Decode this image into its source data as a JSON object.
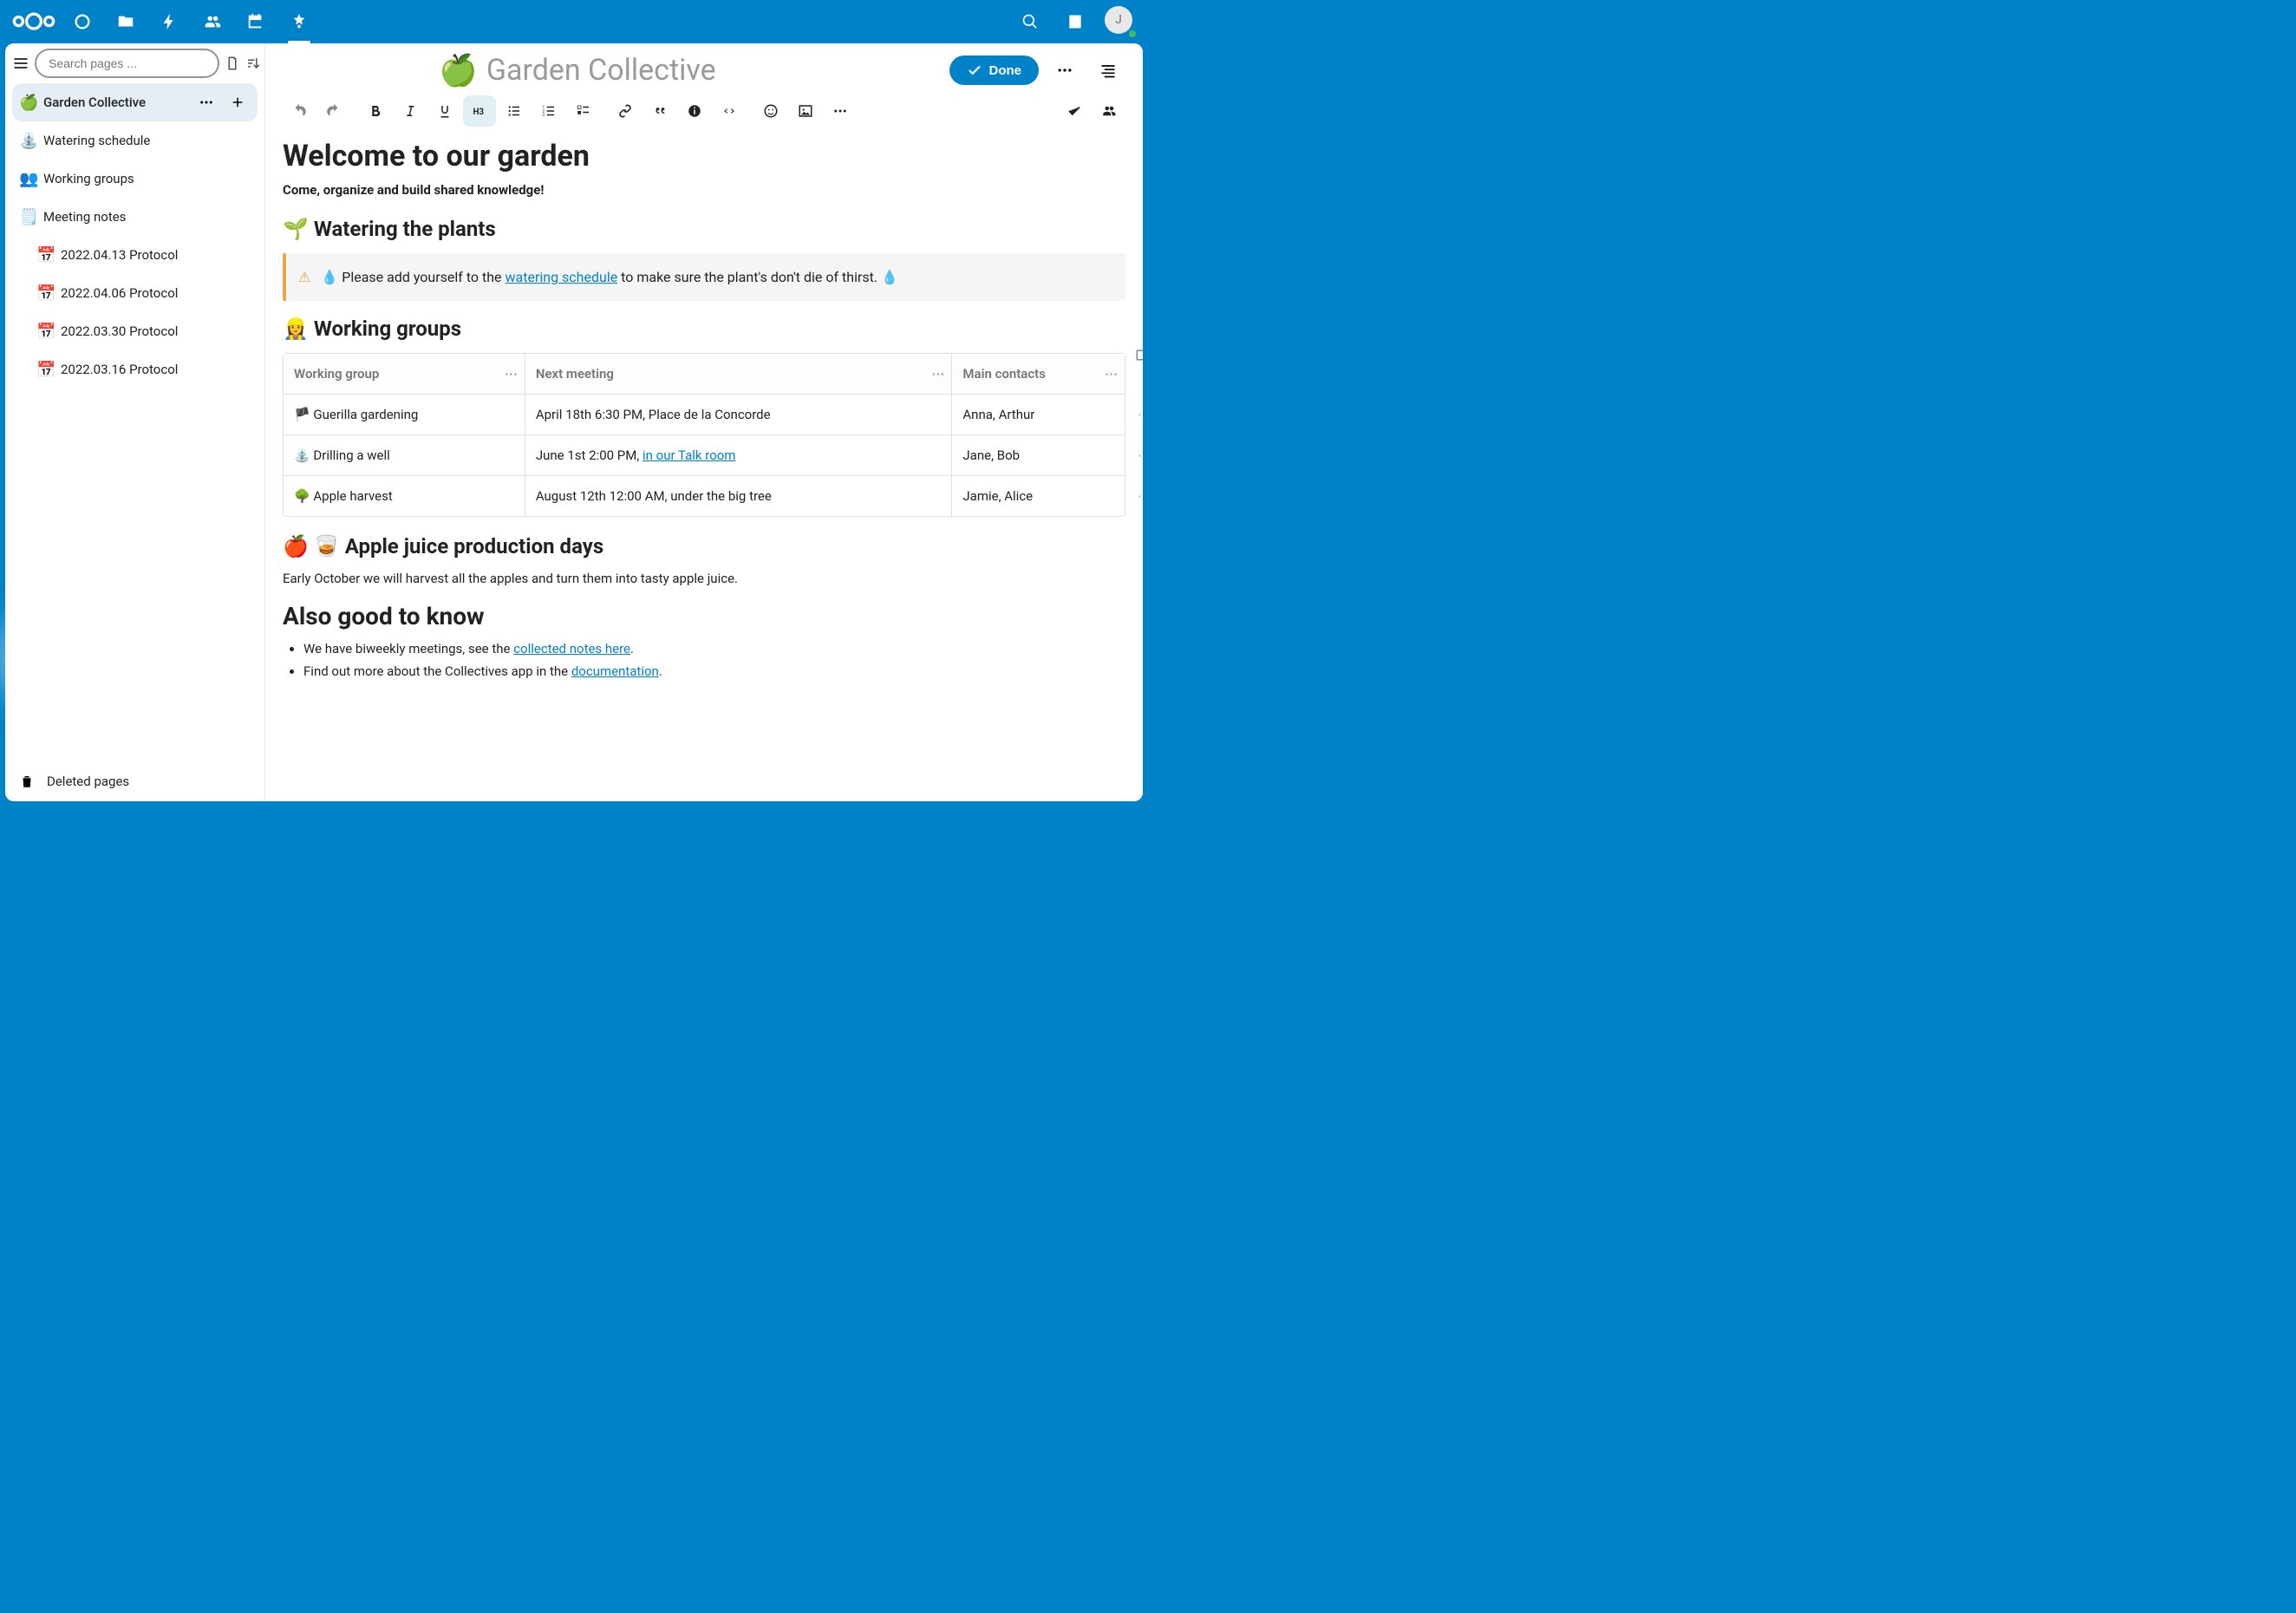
{
  "header": {
    "avatar_initial": "J"
  },
  "sidebar": {
    "search_placeholder": "Search pages ...",
    "root": {
      "emoji": "🍏",
      "label": "Garden Collective"
    },
    "items": [
      {
        "emoji": "⛲",
        "label": "Watering schedule"
      },
      {
        "emoji": "👥",
        "label": "Working groups"
      },
      {
        "emoji": "🗒️",
        "label": "Meeting notes"
      }
    ],
    "meeting_children": [
      {
        "emoji": "📅",
        "label": "2022.04.13 Protocol"
      },
      {
        "emoji": "📅",
        "label": "2022.04.06 Protocol"
      },
      {
        "emoji": "📅",
        "label": "2022.03.30 Protocol"
      },
      {
        "emoji": "📅",
        "label": "2022.03.16 Protocol"
      }
    ],
    "deleted_label": "Deleted pages"
  },
  "page": {
    "icon": "🍏",
    "title": "Garden Collective",
    "done_label": "Done"
  },
  "doc": {
    "h1": "Welcome to our garden",
    "sub": "Come, organize and build shared knowledge!",
    "section1_title": "🌱 Watering the plants",
    "callout_prefix": "💧 Please add yourself to the ",
    "callout_link": "watering schedule",
    "callout_suffix": " to make sure the plant's don't die of thirst. 💧",
    "section2_title": "👷‍♀️ Working groups",
    "table": {
      "headers": [
        "Working group",
        "Next meeting",
        "Main contacts"
      ],
      "rows": [
        {
          "c0": "🏴 Guerilla gardening",
          "c1_text": "April 18th 6:30 PM, Place de la Concorde",
          "c1_link": "",
          "c2": "Anna, Arthur"
        },
        {
          "c0": "⛲ Drilling a well",
          "c1_text": "June 1st 2:00 PM, ",
          "c1_link": "in our Talk room",
          "c2": "Jane, Bob"
        },
        {
          "c0": "🌳 Apple harvest",
          "c1_text": "August 12th 12:00 AM, under the big tree",
          "c1_link": "",
          "c2": "Jamie, Alice"
        }
      ]
    },
    "section3_title": "🍎 🥃 Apple juice production days",
    "section3_body": "Early October we will harvest all the apples and turn them into tasty apple juice.",
    "section4_title": "Also good to know",
    "bullets": [
      {
        "pre": "We have biweekly meetings, see the ",
        "link": "collected notes here",
        "post": "."
      },
      {
        "pre": "Find out more about the Collectives app in the ",
        "link": "documentation",
        "post": "."
      }
    ]
  }
}
